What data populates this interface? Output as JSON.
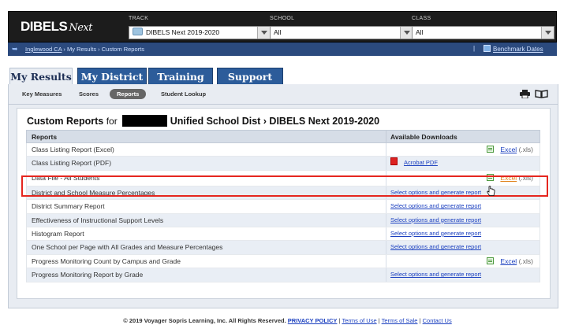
{
  "header": {
    "logo_main": "DIBELS",
    "logo_next": "Next",
    "track_label": "TRACK",
    "track_value": "DIBELS Next 2019-2020",
    "school_label": "SCHOOL",
    "school_value": "All",
    "class_label": "CLASS",
    "class_value": "All"
  },
  "breadcrumb": {
    "home": "Inglewood CA",
    "sep1": "›",
    "item1": "My Results",
    "sep2": "›",
    "item2": "Custom Reports",
    "divider": "|",
    "benchmark": "Benchmark Dates"
  },
  "tabs": [
    {
      "label": "My Results"
    },
    {
      "label": "My District"
    },
    {
      "label": "Training"
    },
    {
      "label": "Support"
    }
  ],
  "subtabs": [
    {
      "label": "Key Measures"
    },
    {
      "label": "Scores"
    },
    {
      "label": "Reports"
    },
    {
      "label": "Student Lookup"
    }
  ],
  "page": {
    "title_main": "Custom Reports",
    "title_for": "for",
    "title_rest": "Unified School Dist › DIBELS Next 2019-2020"
  },
  "table": {
    "col_reports": "Reports",
    "col_downloads": "Available Downloads",
    "rows": [
      {
        "name": "Class Listing Report (Excel)",
        "link": "Excel",
        "suffix": "(.xls)"
      },
      {
        "name": "Class Listing Report (PDF)",
        "link": "Acrobat PDF"
      },
      {
        "name": "Data File - All Students",
        "link": "Excel",
        "suffix": "(.xls)"
      },
      {
        "name": "District and School Measure Percentages",
        "link": "Select options and generate report"
      },
      {
        "name": "District Summary Report",
        "link": "Select options and generate report"
      },
      {
        "name": "Effectiveness of Instructional Support Levels",
        "link": "Select options and generate report"
      },
      {
        "name": "Histogram Report",
        "link": "Select options and generate report"
      },
      {
        "name": "One School per Page with All Grades and Measure Percentages",
        "link": "Select options and generate report"
      },
      {
        "name": "Progress Monitoring Count by Campus and Grade",
        "link": "Excel",
        "suffix": "(.xls)"
      },
      {
        "name": "Progress Monitoring Report by Grade",
        "link": "Select options and generate report"
      }
    ]
  },
  "footer": {
    "copyright": "© 2019 Voyager Sopris Learning, Inc. All Rights Reserved.",
    "privacy": "PRIVACY POLICY",
    "sep": "|",
    "terms_use": "Terms of Use",
    "terms_sale": "Terms of Sale",
    "contact": "Contact Us"
  },
  "colors": {
    "header_bg": "#1c1c1c",
    "crumb_bg": "#2b4a7e",
    "tab_bg": "#2c5c9a",
    "highlight": "#e5261f",
    "link": "#1a3fbf"
  },
  "icons": [
    "track-icon",
    "benchmark-icon",
    "print-icon",
    "book-icon",
    "excel-icon",
    "pdf-icon",
    "hand-cursor-icon",
    "breadcrumb-arrow-icon"
  ]
}
